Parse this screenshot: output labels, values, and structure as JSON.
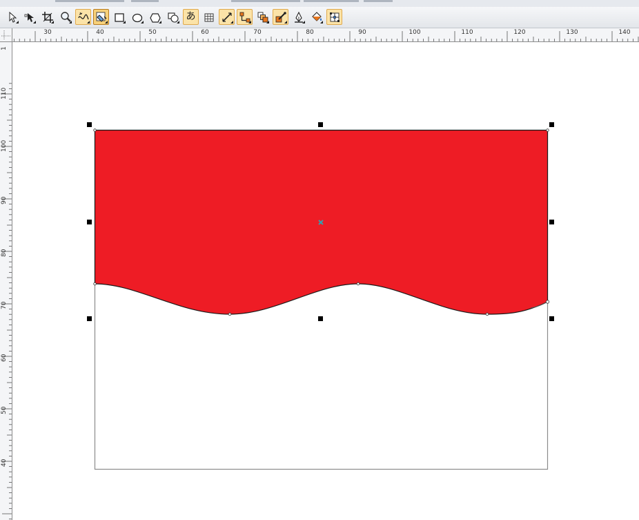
{
  "app": {
    "toolbar": {
      "tools": [
        {
          "name": "pick-tool",
          "icon": "arrow-pointer-icon",
          "state": "normal"
        },
        {
          "name": "shape-tool",
          "icon": "shape-node-icon",
          "state": "normal"
        },
        {
          "name": "crop-tool",
          "icon": "crop-icon",
          "state": "normal"
        },
        {
          "name": "zoom-tool",
          "icon": "magnifier-icon",
          "state": "normal"
        },
        {
          "name": "freehand-tool",
          "icon": "freehand-curve-icon",
          "state": "active"
        },
        {
          "name": "smart-fill-tool",
          "icon": "smart-fill-icon",
          "state": "pressed"
        },
        {
          "name": "rectangle-tool",
          "icon": "rectangle-icon",
          "state": "normal"
        },
        {
          "name": "ellipse-tool",
          "icon": "ellipse-icon",
          "state": "normal"
        },
        {
          "name": "polygon-tool",
          "icon": "polygon-icon",
          "state": "normal"
        },
        {
          "name": "basic-shapes-tool",
          "icon": "basic-shapes-icon",
          "state": "normal"
        },
        {
          "name": "text-tool",
          "icon": "text-glyph-icon",
          "state": "active",
          "glyph": "あ"
        },
        {
          "name": "table-tool",
          "icon": "table-grid-icon",
          "state": "normal"
        },
        {
          "name": "dimension-tool",
          "icon": "dimension-line-icon",
          "state": "active"
        },
        {
          "name": "connector-tool",
          "icon": "connector-icon",
          "state": "active"
        },
        {
          "name": "blend-tool",
          "icon": "blend-squares-icon",
          "state": "normal"
        },
        {
          "name": "eyedropper-tool",
          "icon": "eyedropper-icon",
          "state": "active"
        },
        {
          "name": "outline-pen-tool",
          "icon": "pen-nib-icon",
          "state": "normal"
        },
        {
          "name": "fill-tool",
          "icon": "paint-bucket-icon",
          "state": "normal"
        },
        {
          "name": "interactive-fill-tool",
          "icon": "interactive-fill-icon",
          "state": "active"
        }
      ]
    },
    "ruler": {
      "horizontal_labels": [
        "30",
        "40",
        "50",
        "60",
        "70",
        "80",
        "90",
        "100",
        "110",
        "120",
        "130",
        "140"
      ],
      "vertical_labels": [
        "110",
        "100",
        "90",
        "80",
        "70",
        "60",
        "50",
        "40"
      ],
      "corner_label": "1"
    },
    "canvas": {
      "shape_fill_color": "#ee1c25",
      "outline_color": "#1a1a1a",
      "frame_color": "#8a8a8a",
      "center_marker_color": "#33a0b0",
      "center_marker_icon": "x-cross-icon",
      "handle_color": "#000000"
    }
  }
}
